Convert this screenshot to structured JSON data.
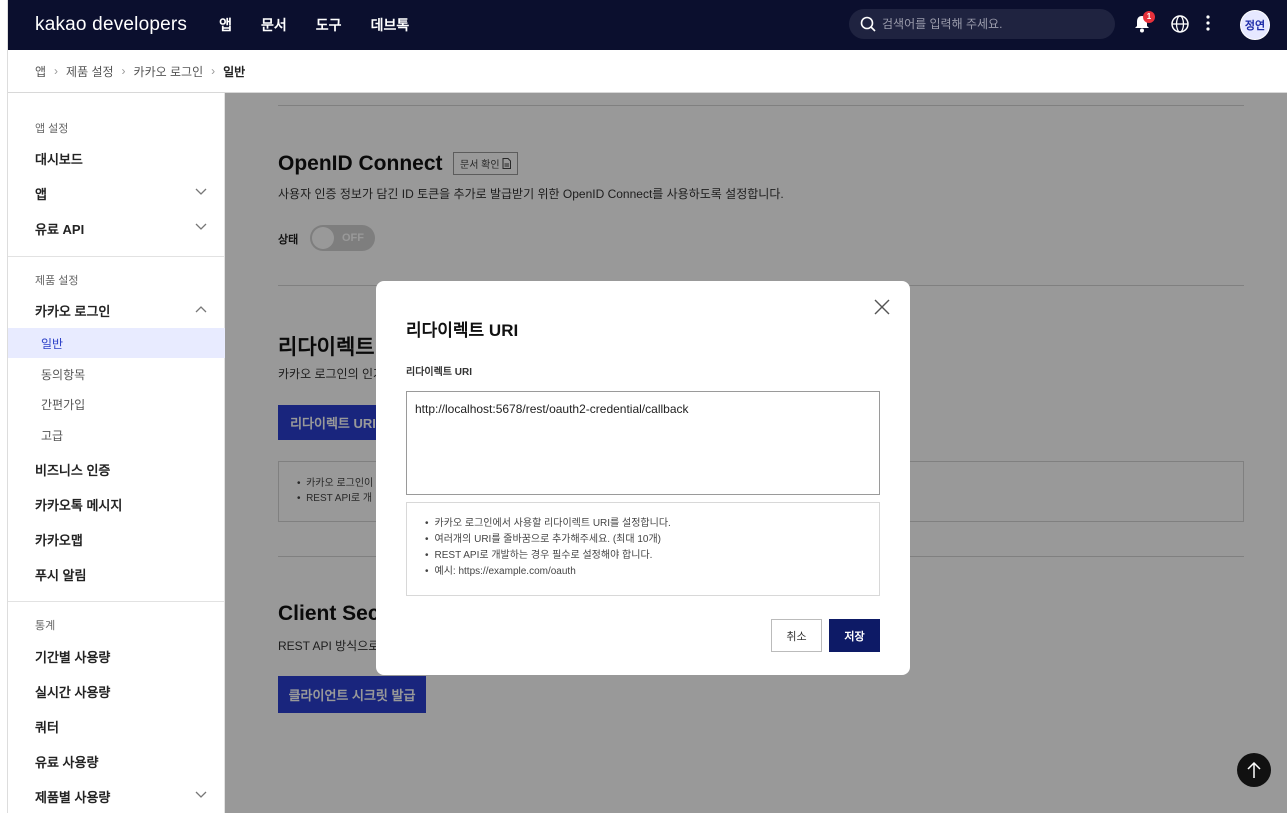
{
  "topbar": {
    "brand": "kakao developers",
    "nav": [
      "앱",
      "문서",
      "도구",
      "데브톡"
    ],
    "search_placeholder": "검색어를 입력해 주세요.",
    "notification_count": "1",
    "avatar": "정연"
  },
  "breadcrumb": {
    "items": [
      "앱",
      "제품 설정",
      "카카오 로그인"
    ],
    "current": "일반"
  },
  "sidebar": {
    "sec_app": "앱 설정",
    "dashboard": "대시보드",
    "app": "앱",
    "paid_api": "유료 API",
    "sec_product": "제품 설정",
    "kakao_login": "카카오 로그인",
    "sub_general": "일반",
    "sub_consent": "동의항목",
    "sub_simple": "간편가입",
    "sub_advanced": "고급",
    "biz": "비즈니스 인증",
    "kakaotalk_msg": "카카오톡 메시지",
    "kakaomap": "카카오맵",
    "push": "푸시 알림",
    "sec_stats": "통계",
    "usage_period": "기간별 사용량",
    "usage_realtime": "실시간 사용량",
    "quota": "쿼터",
    "paid_usage": "유료 사용량",
    "product_usage": "제품별 사용량"
  },
  "main": {
    "oidc_title": "OpenID Connect",
    "doc_button": "문서 확인",
    "oidc_desc": "사용자 인증 정보가 담긴 ID 토큰을 추가로 발급받기 위한 OpenID Connect를 사용하도록 설정합니다.",
    "status_label": "상태",
    "toggle_text": "OFF",
    "redirect_title": "리다이렉트",
    "redirect_desc": "카카오 로그인의 인가",
    "redirect_button": "리다이렉트 URI",
    "note_1": "카카오 로그인이",
    "note_2": "REST API로 개",
    "client_title": "Client Sec",
    "client_desc": "REST API 방식으로",
    "client_button": "클라이언트 시크릿 발급"
  },
  "modal": {
    "title": "리다이렉트 URI",
    "field_label": "리다이렉트 URI",
    "uri_value": "http://localhost:5678/rest/oauth2-credential/callback",
    "help": [
      "카카오 로그인에서 사용할 리다이렉트 URI를 설정합니다.",
      "여러개의 URI를 줄바꿈으로 추가해주세요. (최대 10개)",
      "REST API로 개발하는 경우 필수로 설정해야 합니다.",
      "예시: https://example.com/oauth"
    ],
    "cancel": "취소",
    "save": "저장"
  }
}
